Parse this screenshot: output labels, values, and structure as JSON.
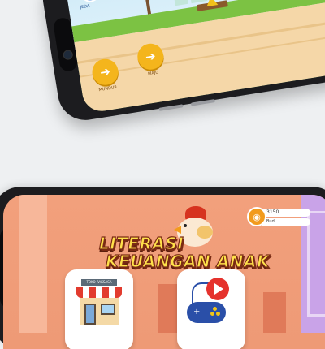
{
  "phone_top": {
    "pause_label": "JEDA",
    "left_button_label": "MUNDUR",
    "right_button_label": "MAJU",
    "left_arrow_icon": "arrow-left-icon",
    "right_arrow_icon": "arrow-right-icon",
    "colors": {
      "button": "#f4b51c",
      "pause": "#3a7bd5",
      "grass": "#7cc243",
      "road": "#f5d7a8"
    }
  },
  "phone_bottom": {
    "title_line1": "LITERASI",
    "title_line2": "KEUANGAN ANAK",
    "coins": "3150",
    "player_name": "Budi",
    "shop_sign": "TOKO RAKSASA",
    "cards": [
      {
        "name": "shop",
        "icon": "store-icon"
      },
      {
        "name": "games",
        "icon": "gamepad-play-icon"
      }
    ],
    "colors": {
      "title": "#ffe14a",
      "title_outline": "#7a2b14",
      "background": "#f2a07c"
    }
  }
}
